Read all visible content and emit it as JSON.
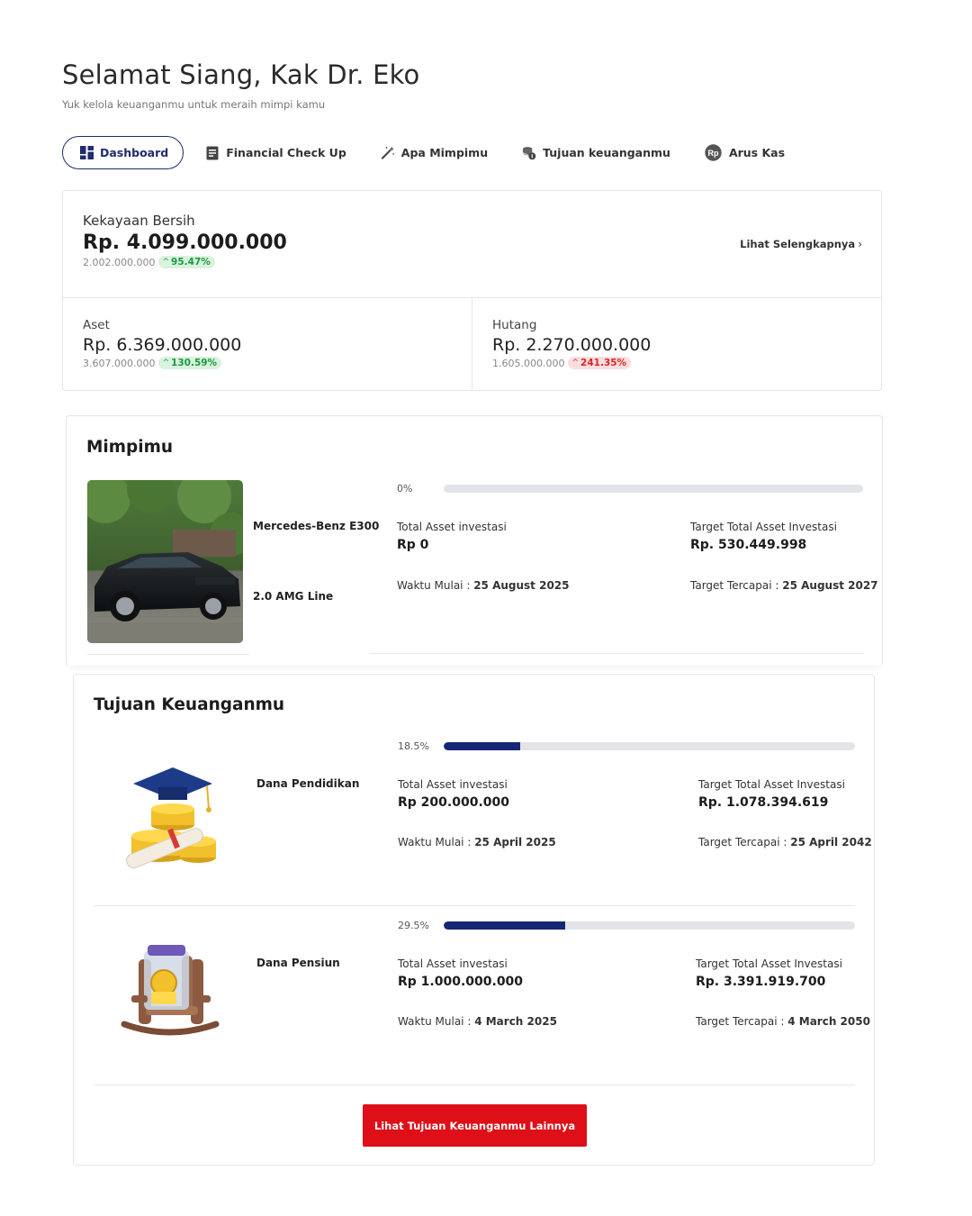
{
  "header": {
    "greeting": "Selamat Siang, Kak Dr. Eko",
    "subtitle": "Yuk kelola keuanganmu untuk meraih mimpi kamu"
  },
  "nav": {
    "items": [
      {
        "label": "Dashboard",
        "icon": "dashboard-icon",
        "active": true
      },
      {
        "label": "Financial Check Up",
        "icon": "document-icon",
        "active": false
      },
      {
        "label": "Apa Mimpimu",
        "icon": "magic-wand-icon",
        "active": false
      },
      {
        "label": "Tujuan keuanganmu",
        "icon": "coins-icon",
        "active": false
      },
      {
        "label": "Arus Kas",
        "icon": "rupiah-icon",
        "active": false
      }
    ],
    "rupiah_symbol": "Rp"
  },
  "net_worth": {
    "label": "Kekayaan Bersih",
    "value": "Rp. 4.099.000.000",
    "previous": "2.002.000.000",
    "change": "95.47%",
    "link": "Lihat Selengkapnya"
  },
  "assets": {
    "label": "Aset",
    "value": "Rp. 6.369.000.000",
    "previous": "3.607.000.000",
    "change": "130.59%"
  },
  "debts": {
    "label": "Hutang",
    "value": "Rp. 2.270.000.000",
    "previous": "1.605.000.000",
    "change": "241.35%"
  },
  "dreams": {
    "title": "Mimpimu",
    "items": [
      {
        "name_line1": "Mercedes-Benz E300",
        "name_line2": "2.0 AMG Line",
        "progress_label": "0%",
        "progress": 0,
        "asset_label": "Total Asset investasi",
        "asset_value": "Rp 0",
        "target_label": "Target Total Asset Investasi",
        "target_value": "Rp. 530.449.998",
        "start_label": "Waktu Mulai :",
        "start_date": "25 August 2025",
        "end_label": "Target Tercapai :",
        "end_date": "25 August 2027"
      }
    ]
  },
  "goals": {
    "title": "Tujuan Keuanganmu",
    "items": [
      {
        "name": "Dana Pendidikan",
        "progress_label": "18.5%",
        "progress": 0.185,
        "asset_label": "Total Asset investasi",
        "asset_value": "Rp 200.000.000",
        "target_label": "Target Total Asset Investasi",
        "target_value": "Rp. 1.078.394.619",
        "start_label": "Waktu Mulai :",
        "start_date": "25 April 2025",
        "end_label": "Target Tercapai :",
        "end_date": "25 April 2042"
      },
      {
        "name": "Dana Pensiun",
        "progress_label": "29.5%",
        "progress": 0.295,
        "asset_label": "Total Asset investasi",
        "asset_value": "Rp 1.000.000.000",
        "target_label": "Target Total Asset Investasi",
        "target_value": "Rp. 3.391.919.700",
        "start_label": "Waktu Mulai :",
        "start_date": "4 March 2025",
        "end_label": "Target Tercapai :",
        "end_date": "4 March 2050"
      }
    ],
    "cta": "Lihat Tujuan Keuanganmu Lainnya"
  },
  "colors": {
    "brand_navy": "#1f2d6b",
    "progress_fill": "#152774",
    "cta_red": "#de0f17",
    "positive": "#1c9a3c",
    "negative": "#d9262c"
  }
}
